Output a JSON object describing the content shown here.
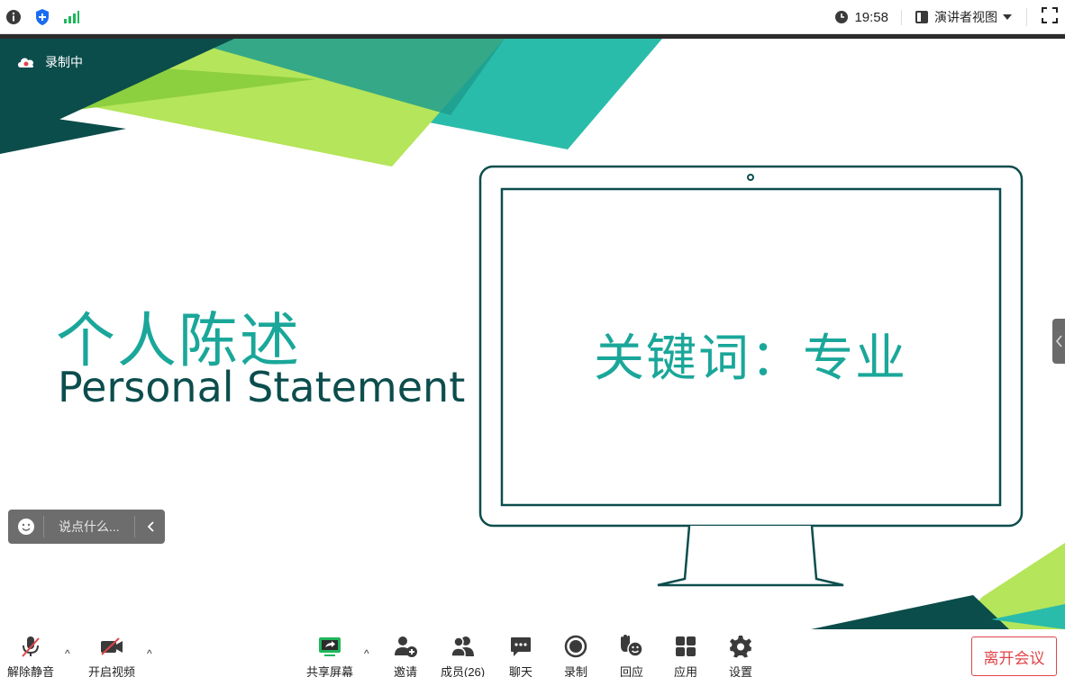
{
  "topbar": {
    "time": "19:58",
    "view_label": "演讲者视图"
  },
  "slide": {
    "recording_label": "录制中",
    "title_cn": "个人陈述",
    "title_en": "Personal Statement",
    "keyword": "关键词：专业"
  },
  "chat": {
    "placeholder": "说点什么..."
  },
  "toolbar": {
    "unmute": "解除静音",
    "start_video": "开启视频",
    "share_screen": "共享屏幕",
    "invite": "邀请",
    "members": "成员(26)",
    "chat": "聊天",
    "record": "录制",
    "reactions": "回应",
    "apps": "应用",
    "settings": "设置",
    "leave": "离开会议"
  },
  "colors": {
    "accent_teal": "#1aa79a",
    "dark_teal": "#0c4d4d",
    "lime": "#b5e55a",
    "share_green": "#1fb65a",
    "leave_red": "#e0454a"
  }
}
